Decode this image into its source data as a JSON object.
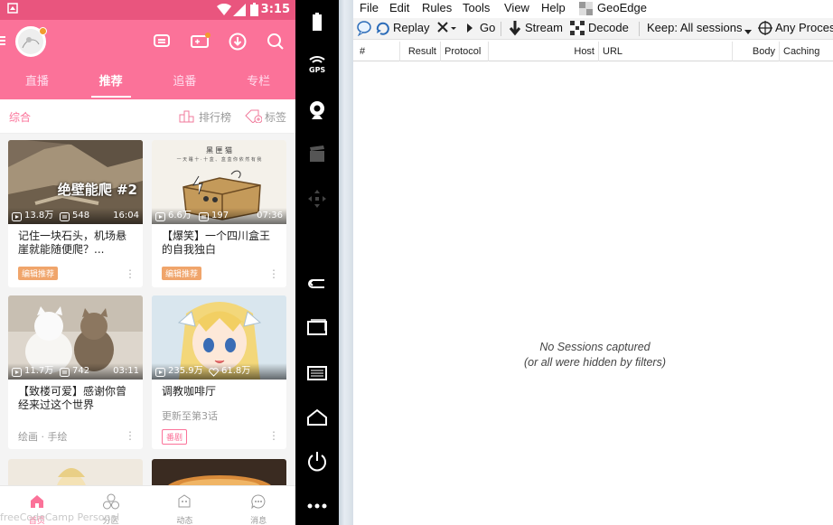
{
  "status_bar": {
    "time": "3:15"
  },
  "app": {
    "tabs": [
      {
        "label": "直播"
      },
      {
        "label": "推荐"
      },
      {
        "label": "追番"
      },
      {
        "label": "专栏"
      }
    ],
    "active_tab": "推荐",
    "subbar": {
      "category": "综合",
      "ranking": "排行榜",
      "tags": "标签"
    },
    "cards": [
      {
        "overlay": "绝壁能爬 #2",
        "plays": "13.8万",
        "danmaku": "548",
        "duration": "16:04",
        "title": "记住一块石头，机场悬崖就能随便爬？...",
        "tag": "编辑推荐"
      },
      {
        "overlay": "黑 匣 猫",
        "overlay_sub": "一 天 睡 十 · 十 盒 、 盒 盒 你 依 然 有 我",
        "plays": "6.6万",
        "danmaku": "197",
        "duration": "07:36",
        "title": "【爆笑】一个四川盒王的自我独白",
        "tag": "编辑推荐"
      },
      {
        "plays": "11.7万",
        "danmaku": "742",
        "duration": "03:11",
        "title": "【致楼可爱】感谢你曾经来过这个世界",
        "sub": "绘画 · 手绘"
      },
      {
        "plays": "235.9万",
        "likes": "61.8万",
        "title": "调教咖啡厅",
        "sub": "更新至第3话",
        "tag": "番剧"
      }
    ],
    "bottom_nav": [
      {
        "label": "首页"
      },
      {
        "label": "分区"
      },
      {
        "label": "动态"
      },
      {
        "label": "消息"
      }
    ],
    "watermark": "freeCodeCamp Personal"
  },
  "fiddler": {
    "menu": [
      "File",
      "Edit",
      "Rules",
      "Tools",
      "View",
      "Help",
      "GeoEdge"
    ],
    "toolbar": {
      "replay": "Replay",
      "go": "Go",
      "stream": "Stream",
      "decode": "Decode",
      "keep": "Keep: All sessions",
      "process": "Any Process"
    },
    "columns": [
      "#",
      "Result",
      "Protocol",
      "Host",
      "URL",
      "Body",
      "Caching"
    ],
    "empty_line1": "No Sessions captured",
    "empty_line2": "(or all were hidden by filters)"
  },
  "colors": {
    "brand_pink": "#fb7299",
    "status_pink": "#e9557e",
    "tag_orange": "#f0a56b"
  }
}
